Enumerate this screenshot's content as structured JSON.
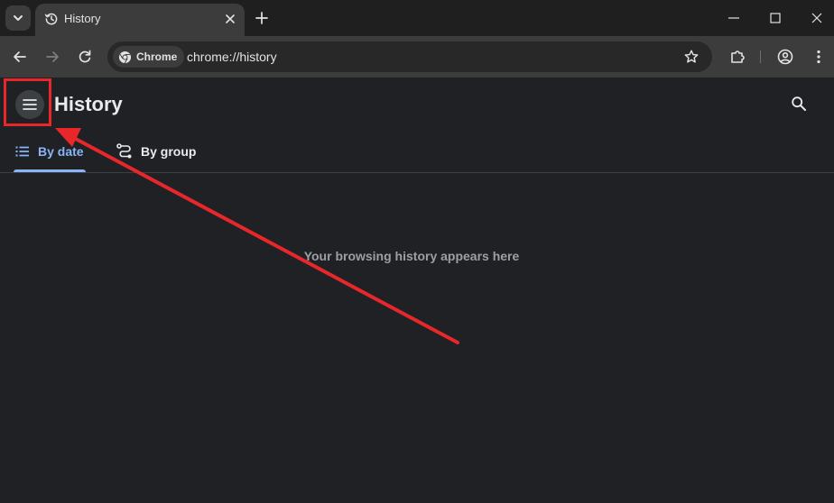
{
  "browser": {
    "tab": {
      "title": "History"
    },
    "omnibox": {
      "chip_label": "Chrome",
      "url": "chrome://history"
    }
  },
  "page": {
    "title": "History",
    "tabs": [
      {
        "label": "By date",
        "active": true
      },
      {
        "label": "By group",
        "active": false
      }
    ],
    "empty_message": "Your browsing history appears here"
  },
  "icons": {
    "tab_search": "chevron-down-icon",
    "tab_favicon": "history-clock-icon",
    "tab_close": "close-icon",
    "new_tab": "plus-icon",
    "back": "arrow-left-icon",
    "forward": "arrow-right-icon",
    "reload": "reload-icon",
    "bookmark": "star-outline-icon",
    "extensions": "puzzle-icon",
    "profile": "account-circle-icon",
    "menu": "kebab-menu-icon",
    "hamburger": "hamburger-menu-icon",
    "search": "search-icon"
  },
  "colors": {
    "page_bg": "#202124",
    "tabstrip_bg": "#1f1f1f",
    "toolbar_bg": "#3c3c3c",
    "accent": "#8ab4f8",
    "annotation": "#e8272b"
  }
}
